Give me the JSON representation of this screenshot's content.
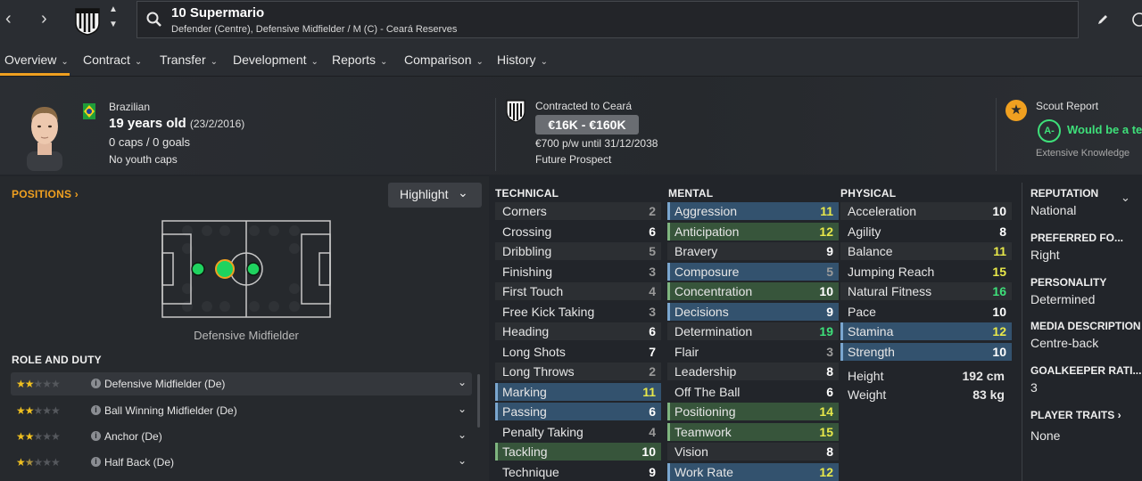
{
  "header": {
    "player_title": "10 Supermario",
    "player_subtitle": "Defender (Centre), Defensive Midfielder / M (C) - Ceará Reserves"
  },
  "tabs": [
    {
      "label": "Overview"
    },
    {
      "label": "Contract"
    },
    {
      "label": "Transfer"
    },
    {
      "label": "Development"
    },
    {
      "label": "Reports"
    },
    {
      "label": "Comparison"
    },
    {
      "label": "History"
    }
  ],
  "profile": {
    "nationality": "Brazilian",
    "age": "19 years old",
    "dob": "(23/2/2016)",
    "caps": "0 caps / 0 goals",
    "youth_caps": "No youth caps"
  },
  "contract": {
    "label": "Contracted to Ceará",
    "value_range": "€16K - €160K",
    "wage": "€700 p/w until 31/12/2038",
    "status": "Future Prospect"
  },
  "scout": {
    "label": "Scout Report",
    "grade": "A-",
    "verdict": "Would be a ter",
    "knowledge": "Extensive Knowledge"
  },
  "positions": {
    "title": "POSITIONS",
    "highlight_label": "Highlight",
    "current_role": "Defensive Midfielder"
  },
  "roles": {
    "title": "ROLE AND DUTY",
    "items": [
      {
        "name": "Defensive Midfielder (De)",
        "stars": 2
      },
      {
        "name": "Ball Winning Midfielder (De)",
        "stars": 2
      },
      {
        "name": "Anchor (De)",
        "stars": 2
      },
      {
        "name": "Half Back (De)",
        "stars": 1.5
      }
    ]
  },
  "technical": {
    "title": "TECHNICAL",
    "attrs": [
      {
        "name": "Corners",
        "value": "2"
      },
      {
        "name": "Crossing",
        "value": "6"
      },
      {
        "name": "Dribbling",
        "value": "5"
      },
      {
        "name": "Finishing",
        "value": "3"
      },
      {
        "name": "First Touch",
        "value": "4"
      },
      {
        "name": "Free Kick Taking",
        "value": "3"
      },
      {
        "name": "Heading",
        "value": "6"
      },
      {
        "name": "Long Shots",
        "value": "7"
      },
      {
        "name": "Long Throws",
        "value": "2"
      },
      {
        "name": "Marking",
        "value": "11"
      },
      {
        "name": "Passing",
        "value": "6"
      },
      {
        "name": "Penalty Taking",
        "value": "4"
      },
      {
        "name": "Tackling",
        "value": "10"
      },
      {
        "name": "Technique",
        "value": "9"
      }
    ]
  },
  "mental": {
    "title": "MENTAL",
    "attrs": [
      {
        "name": "Aggression",
        "value": "11"
      },
      {
        "name": "Anticipation",
        "value": "12"
      },
      {
        "name": "Bravery",
        "value": "9"
      },
      {
        "name": "Composure",
        "value": "5"
      },
      {
        "name": "Concentration",
        "value": "10"
      },
      {
        "name": "Decisions",
        "value": "9"
      },
      {
        "name": "Determination",
        "value": "19"
      },
      {
        "name": "Flair",
        "value": "3"
      },
      {
        "name": "Leadership",
        "value": "8"
      },
      {
        "name": "Off The Ball",
        "value": "6"
      },
      {
        "name": "Positioning",
        "value": "14"
      },
      {
        "name": "Teamwork",
        "value": "15"
      },
      {
        "name": "Vision",
        "value": "8"
      },
      {
        "name": "Work Rate",
        "value": "12"
      }
    ]
  },
  "physical": {
    "title": "PHYSICAL",
    "attrs": [
      {
        "name": "Acceleration",
        "value": "10"
      },
      {
        "name": "Agility",
        "value": "8"
      },
      {
        "name": "Balance",
        "value": "11"
      },
      {
        "name": "Jumping Reach",
        "value": "15"
      },
      {
        "name": "Natural Fitness",
        "value": "16"
      },
      {
        "name": "Pace",
        "value": "10"
      },
      {
        "name": "Stamina",
        "value": "12"
      },
      {
        "name": "Strength",
        "value": "10"
      }
    ],
    "height_label": "Height",
    "height": "192 cm",
    "weight_label": "Weight",
    "weight": "83 kg"
  },
  "side": {
    "reputation_h": "REPUTATION",
    "reputation": "National",
    "foot_h": "PREFERRED FO...",
    "foot": "Right",
    "personality_h": "PERSONALITY",
    "personality": "Determined",
    "media_h": "MEDIA DESCRIPTION",
    "media": "Centre-back",
    "gk_h": "GOALKEEPER RATI...",
    "gk": "3",
    "traits_h": "PLAYER TRAITS",
    "traits": "None"
  },
  "colors": {
    "accent": "#f0a020",
    "value_high_yellow": "#e8e84a",
    "value_very_high_green": "#3ee07a",
    "value_default": "#ffffff",
    "value_low": "#9a9a9a"
  }
}
